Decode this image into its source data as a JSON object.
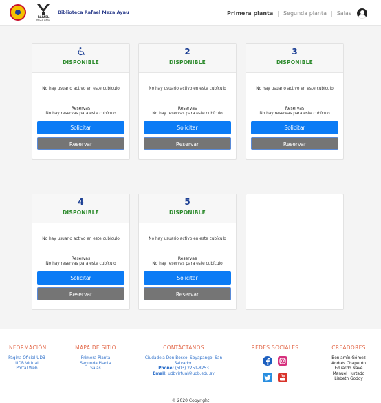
{
  "header": {
    "brand": "Biblioteca Rafael Meza Ayau",
    "logo_line1": "RAFAEL",
    "logo_line2": "MEZA AYAU",
    "nav": [
      {
        "label": "Primera planta",
        "active": true
      },
      {
        "label": "Segunda planta",
        "active": false
      },
      {
        "label": "Salas",
        "active": false
      }
    ],
    "user_icon": "user-avatar-icon"
  },
  "cards": [
    {
      "id": "1",
      "number": "",
      "icon": "wheelchair-icon",
      "status": "DISPONIBLE",
      "user_text": "No hay usuario activo en este cubículo",
      "reservas_title": "Reservas",
      "reservas_text": "No hay reservas para este cubículo",
      "solicitar": "Solicitar",
      "reservar": "Reservar"
    },
    {
      "id": "2",
      "number": "2",
      "status": "DISPONIBLE",
      "user_text": "No hay usuario activo en este cubículo",
      "reservas_title": "Reservas",
      "reservas_text": "No hay reservas para este cubículo",
      "solicitar": "Solicitar",
      "reservar": "Reservar"
    },
    {
      "id": "3",
      "number": "3",
      "status": "DISPONIBLE",
      "user_text": "No hay usuario activo en este cubículo",
      "reservas_title": "Reservas",
      "reservas_text": "No hay reservas para este cubículo",
      "solicitar": "Solicitar",
      "reservar": "Reservar"
    },
    {
      "id": "4",
      "number": "4",
      "status": "DISPONIBLE",
      "user_text": "No hay usuario activo en este cubículo",
      "reservas_title": "Reservas",
      "reservas_text": "No hay reservas para este cubículo",
      "solicitar": "Solicitar",
      "reservar": "Reservar"
    },
    {
      "id": "5",
      "number": "5",
      "status": "DISPONIBLE",
      "user_text": "No hay usuario activo en este cubículo",
      "reservas_title": "Reservas",
      "reservas_text": "No hay reservas para este cubículo",
      "solicitar": "Solicitar",
      "reservar": "Reservar"
    }
  ],
  "footer": {
    "info": {
      "title": "INFORMACIÓN",
      "links": [
        "Página Oficial UDB",
        "UDB Virtual",
        "Portal Web"
      ]
    },
    "mapa": {
      "title": "MAPA DE SITIO",
      "links": [
        "Primera Planta",
        "Segunda Planta",
        "Salas"
      ]
    },
    "contacto": {
      "title": "CONTÁCTANOS",
      "address": "Ciudadela Don Bosco, Soyapango, San Salvador.",
      "phone_label": "Phone:",
      "phone": "(503) 2251-8253",
      "email_label": "Email:",
      "email": "udbvirtual@udb.edu.sv"
    },
    "redes": {
      "title": "REDES SOCIALES",
      "icons": [
        "facebook-icon",
        "instagram-icon",
        "twitter-icon",
        "youtube-icon"
      ]
    },
    "creadores": {
      "title": "CREADORES",
      "names": [
        "Benjamín Gómez",
        "Andrés Chapetón",
        "Eduardo Nave",
        "Manuel Hurtado",
        "Lisbeth Godoy"
      ]
    },
    "copyright": "© 2020 Copyright"
  },
  "colors": {
    "primary_button": "#0b7bf5",
    "secondary_button": "#757575",
    "status_green": "#2e8b2e",
    "number_blue": "#1c3f94",
    "footer_heading": "#e36b4d"
  }
}
